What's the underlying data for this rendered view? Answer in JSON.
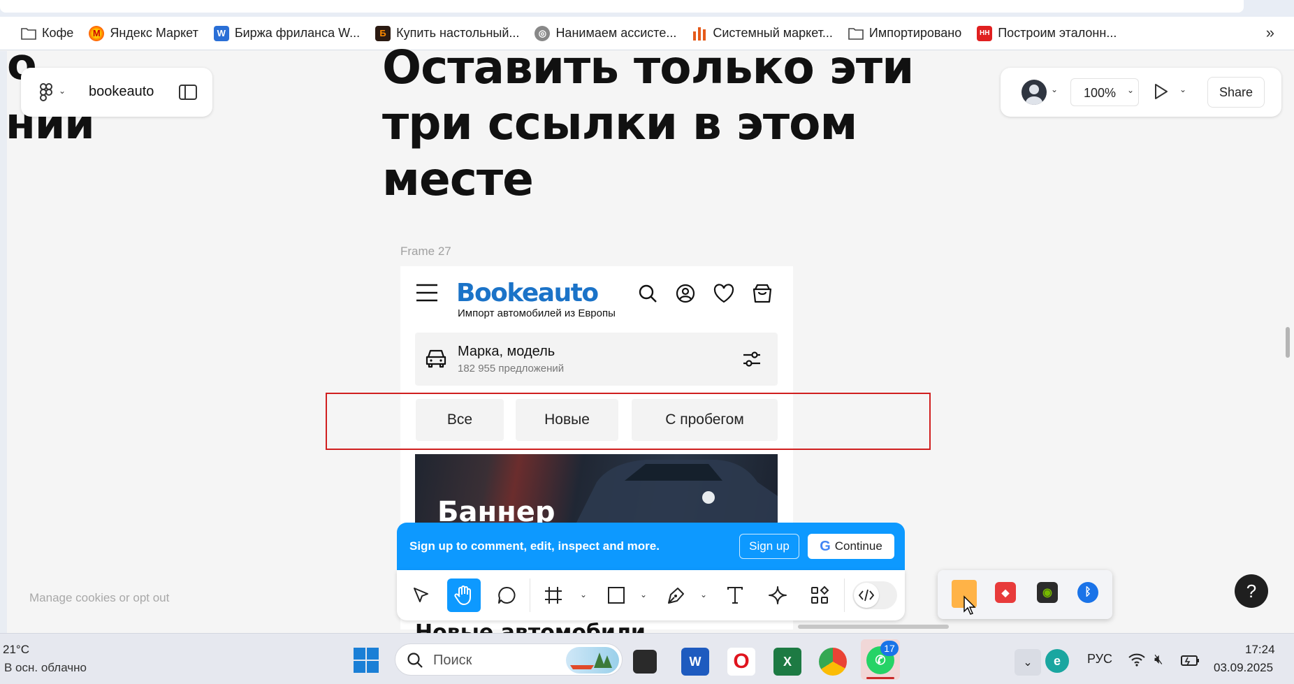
{
  "bookmarks": [
    {
      "label": "Кофе",
      "icon": "folder-icon"
    },
    {
      "label": "Яндекс Маркет",
      "icon": "yandex-market-icon"
    },
    {
      "label": "Биржа фриланса W...",
      "icon": "w-icon"
    },
    {
      "label": "Купить настольный...",
      "icon": "b-icon"
    },
    {
      "label": "Нанимаем ассисте...",
      "icon": "globe-icon"
    },
    {
      "label": "Системный маркет...",
      "icon": "bars-icon"
    },
    {
      "label": "Импортировано",
      "icon": "folder-icon"
    },
    {
      "label": "Построим эталонн...",
      "icon": "hh-icon"
    }
  ],
  "bookmarks_more": "»",
  "figma": {
    "file_name": "bookeauto",
    "zoom": "100%",
    "share_label": "Share"
  },
  "canvas": {
    "left_text_line1": "о",
    "left_text_line2": "нии",
    "heading_line1": "Оставить только эти",
    "heading_line2": "три ссылки в этом",
    "heading_line3": "месте",
    "frame_label": "Frame 27",
    "cookies_label": "Manage cookies or opt out"
  },
  "site": {
    "logo": "Bookeauto",
    "tagline": "Импорт автомобилей из Европы",
    "search_title": "Марка, модель",
    "search_count": "182 955 предложений",
    "tabs": [
      "Все",
      "Новые",
      "С пробегом"
    ],
    "banner_text": "Баннер",
    "next_section": "Новые автомобили"
  },
  "signup_bar": {
    "text": "Sign up to comment, edit, inspect and more.",
    "signup_label": "Sign up",
    "continue_label": "Continue"
  },
  "help_label": "?",
  "taskbar": {
    "weather_temp": "21°C",
    "weather_desc": "В осн. облачно",
    "search_placeholder": "Поиск",
    "whatsapp_badge": "17",
    "language": "РУС",
    "time": "17:24",
    "date": "03.09.2025"
  },
  "colors": {
    "figma_blue": "#0d99ff",
    "logo_blue": "#1b73c8",
    "highlight_red": "#d01f1f"
  }
}
